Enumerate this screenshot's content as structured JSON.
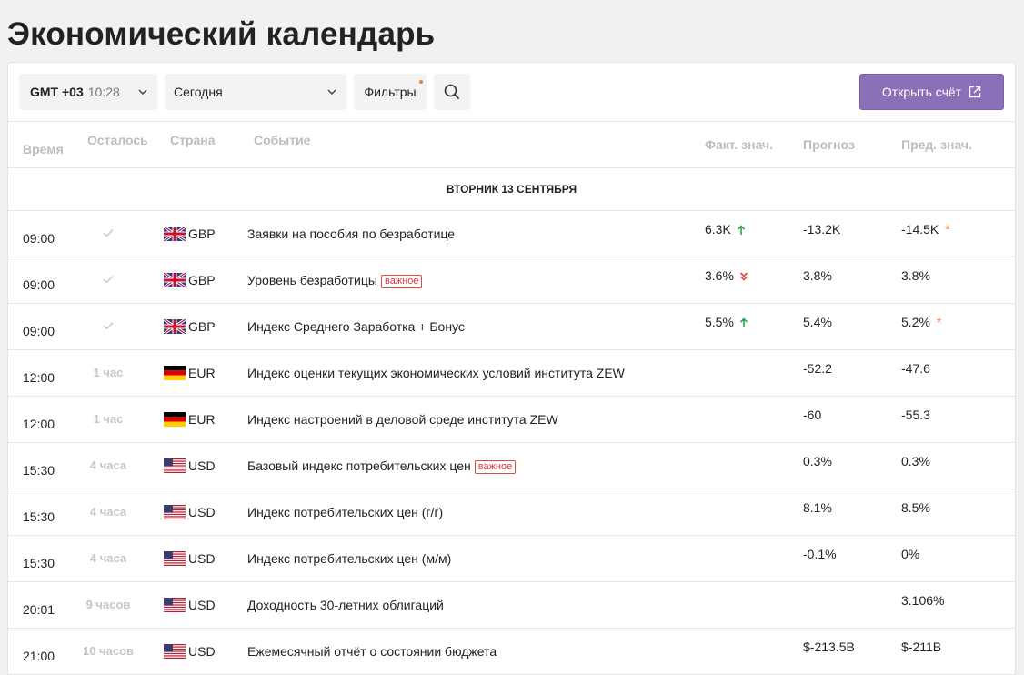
{
  "page": {
    "title": "Экономический календарь"
  },
  "toolbar": {
    "timezone_label": "GMT +03",
    "timezone_time": "10:28",
    "day_select": "Сегодня",
    "filters_label": "Фильтры",
    "open_account_label": "Открыть счёт"
  },
  "columns": {
    "time": "Время",
    "remaining": "Осталось",
    "country": "Страна",
    "event": "Событие",
    "actual": "Факт. знач.",
    "forecast": "Прогноз",
    "previous": "Пред. знач."
  },
  "day_header": "ВТОРНИК 13 СЕНТЯБРЯ",
  "important_label": "важное",
  "colors": {
    "accent": "#8a70b8",
    "up": "#2aa84a",
    "down": "#e04848",
    "important": "#d83a3a",
    "star": "#f07c3a"
  },
  "events": [
    {
      "time": "09:00",
      "remaining": "",
      "done": true,
      "flag": "gb",
      "currency": "GBP",
      "event": "Заявки на пособия по безработице",
      "important": false,
      "actual": "6.3K",
      "trend": "up",
      "forecast": "-13.2K",
      "previous": "-14.5K",
      "revised": true
    },
    {
      "time": "09:00",
      "remaining": "",
      "done": true,
      "flag": "gb",
      "currency": "GBP",
      "event": "Уровень безработицы",
      "important": true,
      "actual": "3.6%",
      "trend": "down",
      "forecast": "3.8%",
      "previous": "3.8%",
      "revised": false
    },
    {
      "time": "09:00",
      "remaining": "",
      "done": true,
      "flag": "gb",
      "currency": "GBP",
      "event": "Индекс Среднего Заработка + Бонус",
      "important": false,
      "actual": "5.5%",
      "trend": "up",
      "forecast": "5.4%",
      "previous": "5.2%",
      "revised": true
    },
    {
      "time": "12:00",
      "remaining": "1 час",
      "done": false,
      "flag": "de",
      "currency": "EUR",
      "event": "Индекс оценки текущих экономических условий института ZEW",
      "important": false,
      "actual": "",
      "trend": "",
      "forecast": "-52.2",
      "previous": "-47.6",
      "revised": false
    },
    {
      "time": "12:00",
      "remaining": "1 час",
      "done": false,
      "flag": "de",
      "currency": "EUR",
      "event": "Индекс настроений в деловой среде института ZEW",
      "important": false,
      "actual": "",
      "trend": "",
      "forecast": "-60",
      "previous": "-55.3",
      "revised": false
    },
    {
      "time": "15:30",
      "remaining": "4 часа",
      "done": false,
      "flag": "us",
      "currency": "USD",
      "event": "Базовый индекс потребительских цен",
      "important": true,
      "actual": "",
      "trend": "",
      "forecast": "0.3%",
      "previous": "0.3%",
      "revised": false
    },
    {
      "time": "15:30",
      "remaining": "4 часа",
      "done": false,
      "flag": "us",
      "currency": "USD",
      "event": "Индекс потребительских цен (г/г)",
      "important": false,
      "actual": "",
      "trend": "",
      "forecast": "8.1%",
      "previous": "8.5%",
      "revised": false
    },
    {
      "time": "15:30",
      "remaining": "4 часа",
      "done": false,
      "flag": "us",
      "currency": "USD",
      "event": "Индекс потребительских цен (м/м)",
      "important": false,
      "actual": "",
      "trend": "",
      "forecast": "-0.1%",
      "previous": "0%",
      "revised": false
    },
    {
      "time": "20:01",
      "remaining": "9 часов",
      "done": false,
      "flag": "us",
      "currency": "USD",
      "event": "Доходность 30-летних облигаций",
      "important": false,
      "actual": "",
      "trend": "",
      "forecast": "",
      "previous": "3.106%",
      "revised": false
    },
    {
      "time": "21:00",
      "remaining": "10 часов",
      "done": false,
      "flag": "us",
      "currency": "USD",
      "event": "Ежемесячный отчёт о состоянии бюджета",
      "important": false,
      "actual": "",
      "trend": "",
      "forecast": "$-213.5B",
      "previous": "$-211B",
      "revised": false
    }
  ]
}
